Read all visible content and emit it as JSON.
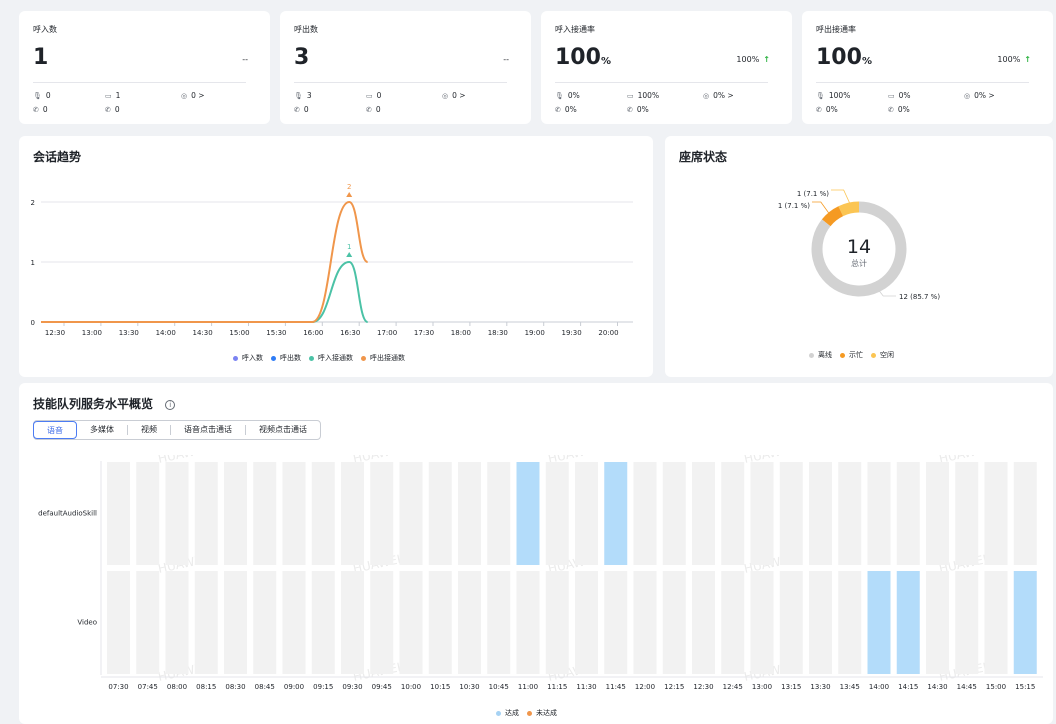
{
  "kpis": [
    {
      "title": "呼入数",
      "value": "1",
      "unit": "",
      "comparison": "--",
      "arrow": "",
      "stats": [
        "0",
        "1",
        "0 >",
        "0",
        "0"
      ]
    },
    {
      "title": "呼出数",
      "value": "3",
      "unit": "",
      "comparison": "--",
      "arrow": "",
      "stats": [
        "3",
        "0",
        "0 >",
        "0",
        "0"
      ]
    },
    {
      "title": "呼入接通率",
      "value": "100",
      "unit": "%",
      "comparison": "100%",
      "arrow": "↑",
      "stats": [
        "0%",
        "100%",
        "0% >",
        "0%",
        "0%"
      ]
    },
    {
      "title": "呼出接通率",
      "value": "100",
      "unit": "%",
      "comparison": "100%",
      "arrow": "↑",
      "stats": [
        "100%",
        "0%",
        "0% >",
        "0%",
        "0%"
      ]
    }
  ],
  "stat_icons": [
    "microphone-icon",
    "video-camera-icon",
    "chat-bubble-icon",
    "phone-icon",
    "phone-forward-icon"
  ],
  "trend": {
    "title": "会话趋势",
    "chart_data": {
      "type": "line",
      "x": [
        "12:30",
        "13:00",
        "13:30",
        "14:00",
        "14:30",
        "15:00",
        "15:30",
        "16:00",
        "16:30",
        "17:00",
        "17:30",
        "18:00",
        "18:30",
        "19:00",
        "19:30",
        "20:00"
      ],
      "ylim": [
        0,
        2
      ],
      "yticks": [
        "0",
        "1",
        "2"
      ],
      "series": [
        {
          "name": "呼入数",
          "color": "#7b83f2",
          "points": []
        },
        {
          "name": "呼出数",
          "color": "#2e7cf6",
          "points": []
        },
        {
          "name": "呼入接通数",
          "color": "#4bc2a6",
          "points": [
            [
              "12:00",
              0
            ],
            [
              "16:00",
              0
            ],
            [
              "16:30",
              1
            ],
            [
              "16:45",
              0
            ]
          ],
          "peak_label": "1"
        },
        {
          "name": "呼出接通数",
          "color": "#f0964b",
          "points": [
            [
              "12:00",
              0
            ],
            [
              "16:00",
              0
            ],
            [
              "16:30",
              2
            ],
            [
              "16:45",
              1
            ]
          ],
          "peak_label": "2"
        }
      ]
    }
  },
  "seats": {
    "title": "座席状态",
    "total": "14",
    "total_label": "总计",
    "chart_data": {
      "type": "pie",
      "slices": [
        {
          "name": "离线",
          "value": 12,
          "label": "12 (85.7 %)",
          "color": "#d2d2d2"
        },
        {
          "name": "示忙",
          "value": 1,
          "label": "1 (7.1 %)",
          "color": "#f59a23"
        },
        {
          "name": "空闲",
          "value": 1,
          "label": "1 (7.1 %)",
          "color": "#fbc553"
        }
      ]
    }
  },
  "skill": {
    "title": "技能队列服务水平概览",
    "info_icon": "info-icon",
    "tabs": [
      "语音",
      "多媒体",
      "视频",
      "语音点击通话",
      "视频点击通话"
    ],
    "active_tab": 0,
    "watermark": "HUAWEI",
    "chart_data": {
      "type": "heatmap",
      "rows": [
        "defaultAudioSkill",
        "Video"
      ],
      "x": [
        "07:30",
        "07:45",
        "08:00",
        "08:15",
        "08:30",
        "08:45",
        "09:00",
        "09:15",
        "09:30",
        "09:45",
        "10:00",
        "10:15",
        "10:30",
        "10:45",
        "11:00",
        "11:15",
        "11:30",
        "11:45",
        "12:00",
        "12:15",
        "12:30",
        "12:45",
        "13:00",
        "13:15",
        "13:30",
        "13:45",
        "14:00",
        "14:15",
        "14:30",
        "14:45",
        "15:00",
        "15:15"
      ],
      "achieved": {
        "defaultAudioSkill": [
          "11:00",
          "11:45"
        ],
        "Video": [
          "14:00",
          "14:15",
          "15:15"
        ]
      },
      "legend": [
        {
          "name": "达成",
          "color": "#a6d2f3"
        },
        {
          "name": "未达成",
          "color": "#f0964b"
        }
      ],
      "colors": {
        "achieved": "#b3dcfa",
        "empty": "#f2f2f2"
      }
    }
  }
}
